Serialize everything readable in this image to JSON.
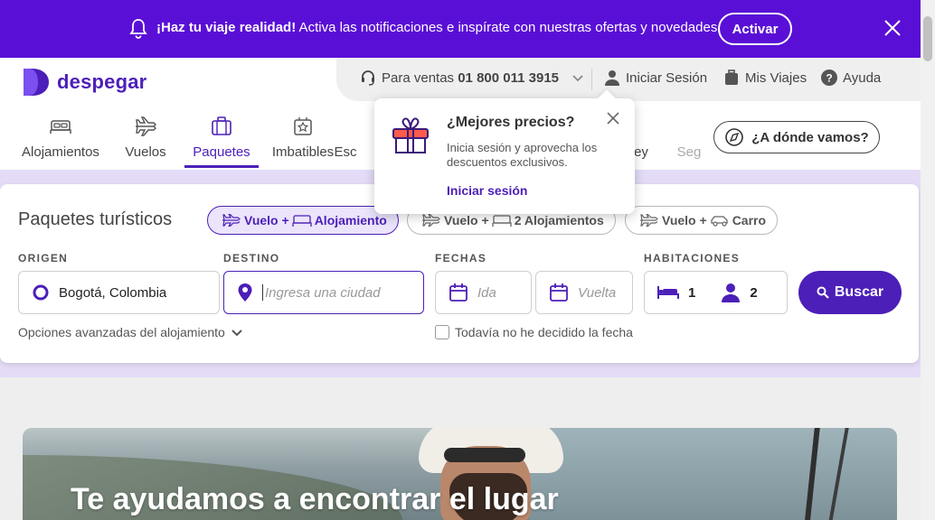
{
  "colors": {
    "brand": "#4c1fb8",
    "banner": "#5a0fd6",
    "selected_chip_bg": "#ebe4fb"
  },
  "notification": {
    "bold_text": "¡Haz tu viaje realidad!",
    "text": " Activa las notificaciones e inspírate con nuestras ofertas y novedades.",
    "button": "Activar"
  },
  "header": {
    "logo": "despegar",
    "topbar": {
      "sales_label": "Para ventas",
      "sales_phone": "01 800 011 3915",
      "login": "Iniciar Sesión",
      "trips": "Mis Viajes",
      "help": "Ayuda"
    },
    "tabs": [
      {
        "label": "Alojamientos",
        "icon": "bed-icon"
      },
      {
        "label": "Vuelos",
        "icon": "plane-icon"
      },
      {
        "label": "Paquetes",
        "icon": "suitcase-icon"
      },
      {
        "label": "Imbatibles",
        "icon": "star-tag-icon"
      },
      {
        "label": "Esc",
        "icon": "partial"
      },
      {
        "label": "ey",
        "icon": "partial"
      },
      {
        "label": "Seg",
        "icon": "partial"
      }
    ],
    "where_button": "¿A dónde vamos?"
  },
  "popover": {
    "title": "¿Mejores precios?",
    "body": "Inicia sesión y aprovecha los descuentos exclusivos.",
    "link": "Iniciar sesión"
  },
  "search": {
    "title": "Paquetes turísticos",
    "chips": [
      {
        "label_a": "Vuelo",
        "label_b": "Alojamiento",
        "selected": true
      },
      {
        "label_a": "Vuelo",
        "label_b": "2 Alojamientos",
        "selected": false
      },
      {
        "label_a": "Vuelo",
        "label_b": "Carro",
        "selected": false
      }
    ],
    "origin_label": "ORIGEN",
    "origin_value": "Bogotá, Colombia",
    "destination_label": "DESTINO",
    "destination_placeholder": "Ingresa una ciudad",
    "dates_label": "FECHAS",
    "departure_placeholder": "Ida",
    "return_placeholder": "Vuelta",
    "rooms_label": "HABITACIONES",
    "rooms": "1",
    "guests": "2",
    "search_button": "Buscar",
    "advanced": "Opciones avanzadas del alojamiento",
    "no_date": "Todavía no he decidido la fecha"
  },
  "hero": {
    "headline": "Te ayudamos a encontrar el lugar"
  }
}
